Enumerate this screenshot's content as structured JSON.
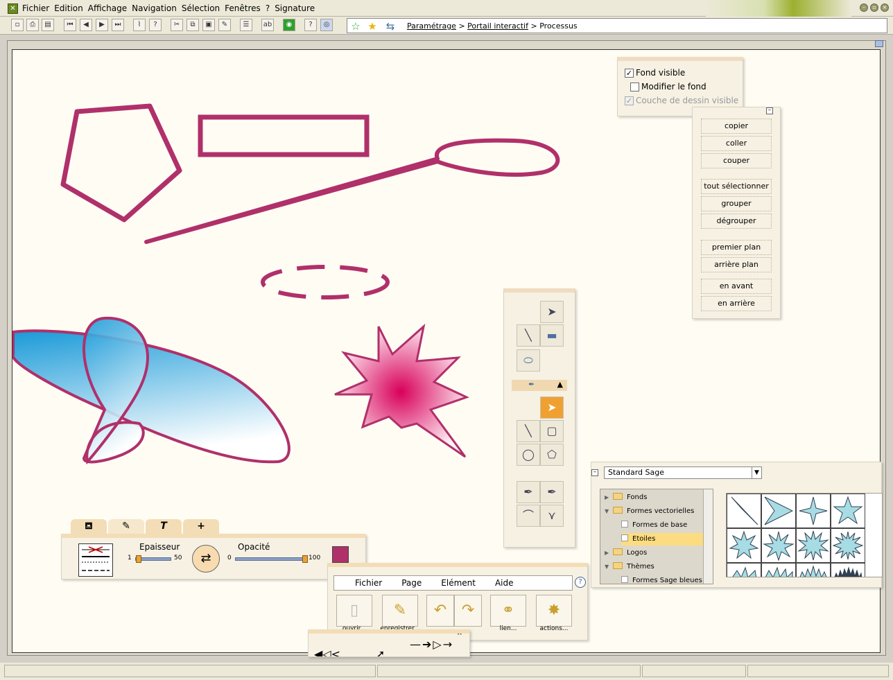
{
  "menubar": {
    "items": [
      "Fichier",
      "Edition",
      "Affichage",
      "Navigation",
      "Sélection",
      "Fenêtres",
      "?",
      "Signature"
    ]
  },
  "breadcrumb": {
    "items": [
      "Paramétrage",
      "Portail interactif",
      "Processus"
    ],
    "separator": ">"
  },
  "fond_panel": {
    "fond_visible": "Fond visible",
    "modifier_fond": "Modifier le fond",
    "couche_dessin": "Couche de dessin visible"
  },
  "edit_panel": {
    "items": [
      "copier",
      "coller",
      "couper",
      "tout sélectionner",
      "grouper",
      "dégrouper",
      "premier plan",
      "arrière plan",
      "en avant",
      "en arrière"
    ]
  },
  "style_panel": {
    "epaisseur_label": "Epaisseur",
    "epaisseur_min": "1",
    "epaisseur_max": "50",
    "epaisseur_value": 1,
    "opacite_label": "Opacité",
    "opacite_min": "0",
    "opacite_max": "100",
    "opacite_value": 100,
    "stroke_color": "#b0306a"
  },
  "fichier_panel": {
    "menu": [
      "Fichier",
      "Page",
      "Elément",
      "Aide"
    ],
    "buttons": [
      "ouvrir...",
      "enregistrer...",
      "lien...",
      "actions..."
    ]
  },
  "library_panel": {
    "dropdown_value": "Standard Sage",
    "tree": [
      {
        "label": "Fonds",
        "expanded": false
      },
      {
        "label": "Formes vectorielles",
        "expanded": true
      },
      {
        "label": "Formes de base",
        "leaf": true
      },
      {
        "label": "Etoiles",
        "leaf": true,
        "selected": true
      },
      {
        "label": "Logos",
        "expanded": false
      },
      {
        "label": "Thèmes",
        "expanded": true
      },
      {
        "label": "Formes Sage bleues",
        "leaf": true
      }
    ]
  },
  "colors": {
    "shape_stroke": "#b0306a",
    "gradient_blue": "#1a9ad8",
    "canvas_bg": "#fefcf3",
    "panel_bg": "#f6f1e3"
  }
}
